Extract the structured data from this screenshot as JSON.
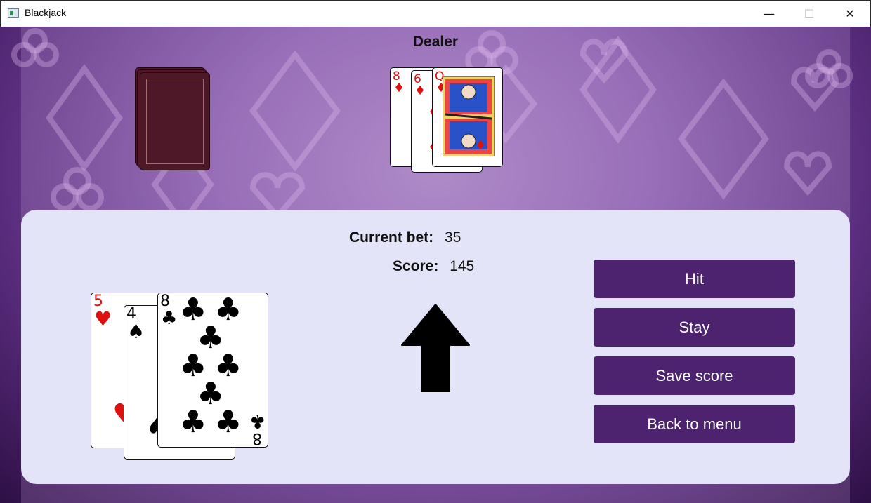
{
  "window": {
    "title": "Blackjack",
    "minimize": "—",
    "maximize": "☐",
    "close": "✕"
  },
  "dealer": {
    "label": "Dealer",
    "cards": [
      {
        "rank": "8",
        "suit": "♦",
        "color": "red"
      },
      {
        "rank": "6",
        "suit": "♦",
        "color": "red"
      },
      {
        "rank": "Q",
        "suit": "♦",
        "color": "red"
      }
    ]
  },
  "player": {
    "current_bet_label": "Current bet:",
    "current_bet_value": "35",
    "score_label": "Score:",
    "score_value": "145",
    "cards": [
      {
        "rank": "5",
        "suit": "♥",
        "color": "red"
      },
      {
        "rank": "4",
        "suit": "♠",
        "color": "black"
      },
      {
        "rank": "8",
        "suit": "♣",
        "color": "black"
      }
    ]
  },
  "buttons": {
    "hit": "Hit",
    "stay": "Stay",
    "save_score": "Save score",
    "back_to_menu": "Back to menu"
  },
  "icons": {
    "turn_indicator": "up-arrow-icon"
  },
  "colors": {
    "button": "#4d2370",
    "panel": "#e4e4f8",
    "card_back": "#4e1828"
  }
}
